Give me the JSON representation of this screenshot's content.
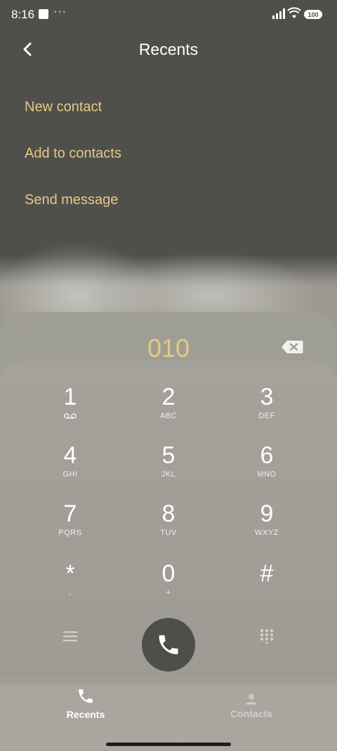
{
  "status_bar": {
    "time": "8:16",
    "dots": "···",
    "battery": "100"
  },
  "header": {
    "title": "Recents"
  },
  "menu": [
    {
      "label": "New contact"
    },
    {
      "label": "Add to contacts"
    },
    {
      "label": "Send message"
    }
  ],
  "dialer": {
    "number": "010",
    "keys": [
      {
        "digit": "1",
        "letters": ""
      },
      {
        "digit": "2",
        "letters": "ABC"
      },
      {
        "digit": "3",
        "letters": "DEF"
      },
      {
        "digit": "4",
        "letters": "GHI"
      },
      {
        "digit": "5",
        "letters": "JKL"
      },
      {
        "digit": "6",
        "letters": "MNO"
      },
      {
        "digit": "7",
        "letters": "PQRS"
      },
      {
        "digit": "8",
        "letters": "TUV"
      },
      {
        "digit": "9",
        "letters": "WXYZ"
      },
      {
        "digit": "*",
        "letters": ","
      },
      {
        "digit": "0",
        "letters": "+"
      },
      {
        "digit": "#",
        "letters": ""
      }
    ]
  },
  "nav": {
    "recents": "Recents",
    "contacts": "Contacts"
  },
  "colors": {
    "accent": "#e7c881",
    "background": "#4f504c",
    "call_button": "#4e4e4b"
  },
  "icons": [
    "back-icon",
    "voicemail-icon",
    "backspace-icon",
    "menu-icon",
    "phone-icon",
    "dialpad-icon",
    "contacts-icon"
  ]
}
